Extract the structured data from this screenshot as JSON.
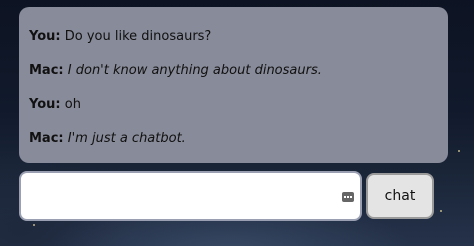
{
  "chat": {
    "messages": [
      {
        "speaker": "You:",
        "text": "Do you like dinosaurs?"
      },
      {
        "speaker": "Mac:",
        "text": "I don't know anything about dinosaurs."
      },
      {
        "speaker": "You:",
        "text": "oh"
      },
      {
        "speaker": "Mac:",
        "text": "I'm just a chatbot."
      }
    ]
  },
  "input": {
    "value": "",
    "icon": "keyboard-icon"
  },
  "button": {
    "label": "chat"
  },
  "colors": {
    "chat_log_bg": "#888b99",
    "input_bg": "#ffffff",
    "button_bg": "#e4e4e4"
  }
}
